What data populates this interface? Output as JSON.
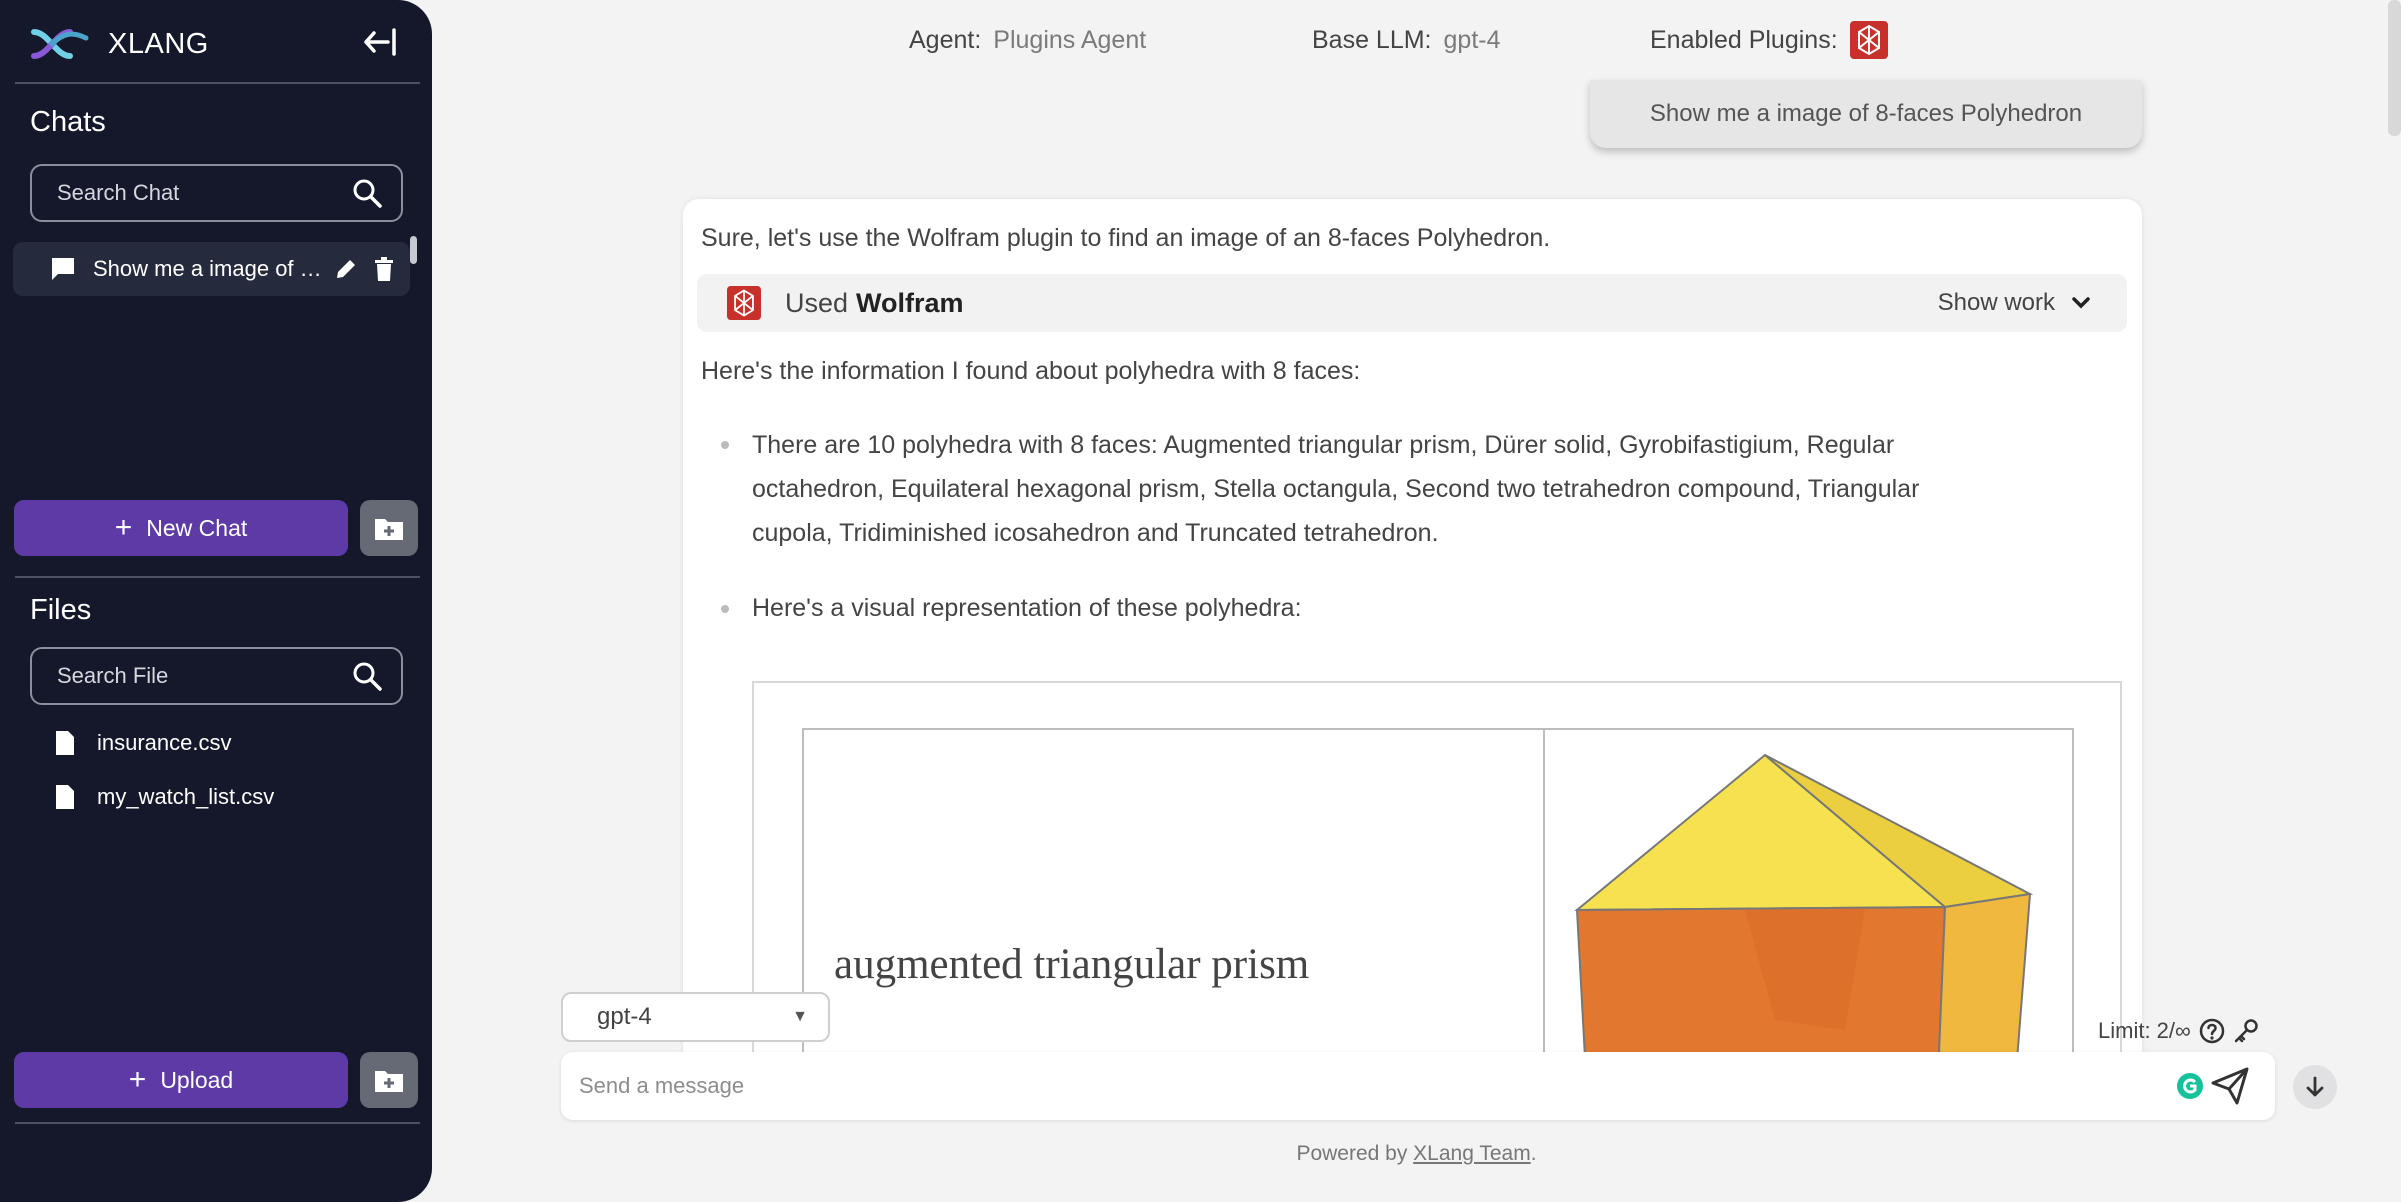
{
  "sidebar": {
    "brand": "XLANG",
    "chats_title": "Chats",
    "search_chat_placeholder": "Search Chat",
    "chat_items": [
      {
        "label": "Show me a image of 8-faces Polyhedron"
      }
    ],
    "new_chat_label": "New Chat",
    "files_title": "Files",
    "search_file_placeholder": "Search File",
    "files": [
      {
        "name": "insurance.csv"
      },
      {
        "name": "my_watch_list.csv"
      }
    ],
    "upload_label": "Upload"
  },
  "header": {
    "agent_key": "Agent:",
    "agent_value": "Plugins Agent",
    "llm_key": "Base LLM:",
    "llm_value": "gpt-4",
    "plugins_key": "Enabled Plugins:"
  },
  "conversation": {
    "user_message": "Show me a image of 8-faces Polyhedron",
    "assistant_intro": "Sure, let's use the Wolfram plugin to find an image of an 8-faces Polyhedron.",
    "plugin_used_prefix": "Used",
    "plugin_used_name": "Wolfram",
    "show_work_label": "Show work",
    "info_line": "Here's the information I found about polyhedra with 8 faces:",
    "bullets": [
      {
        "line1": "There are 10 polyhedra with 8 faces: Augmented triangular prism, Dürer solid, Gyrobifastigium, Regular",
        "line2": "octahedron, Equilateral hexagonal prism, Stella octangula, Second two tetrahedron compound, Triangular",
        "line3": "cupola, Tridiminished icosahedron and Truncated tetrahedron."
      },
      {
        "line1": "Here's a visual representation of these polyhedra:"
      }
    ],
    "image_label": "augmented triangular prism"
  },
  "composer": {
    "model_selected": "gpt-4",
    "limit_text": "Limit: 2/∞",
    "message_placeholder": "Send a message"
  },
  "footer": {
    "prefix": "Powered by ",
    "link_text": "XLang Team",
    "suffix": "."
  },
  "colors": {
    "sidebar_bg": "#14182a",
    "primary_button": "#5e3aa6",
    "wolfram_red": "#c8302b",
    "polyhedron_yellow": "#f6e24e",
    "polyhedron_orange": "#e2772f"
  }
}
